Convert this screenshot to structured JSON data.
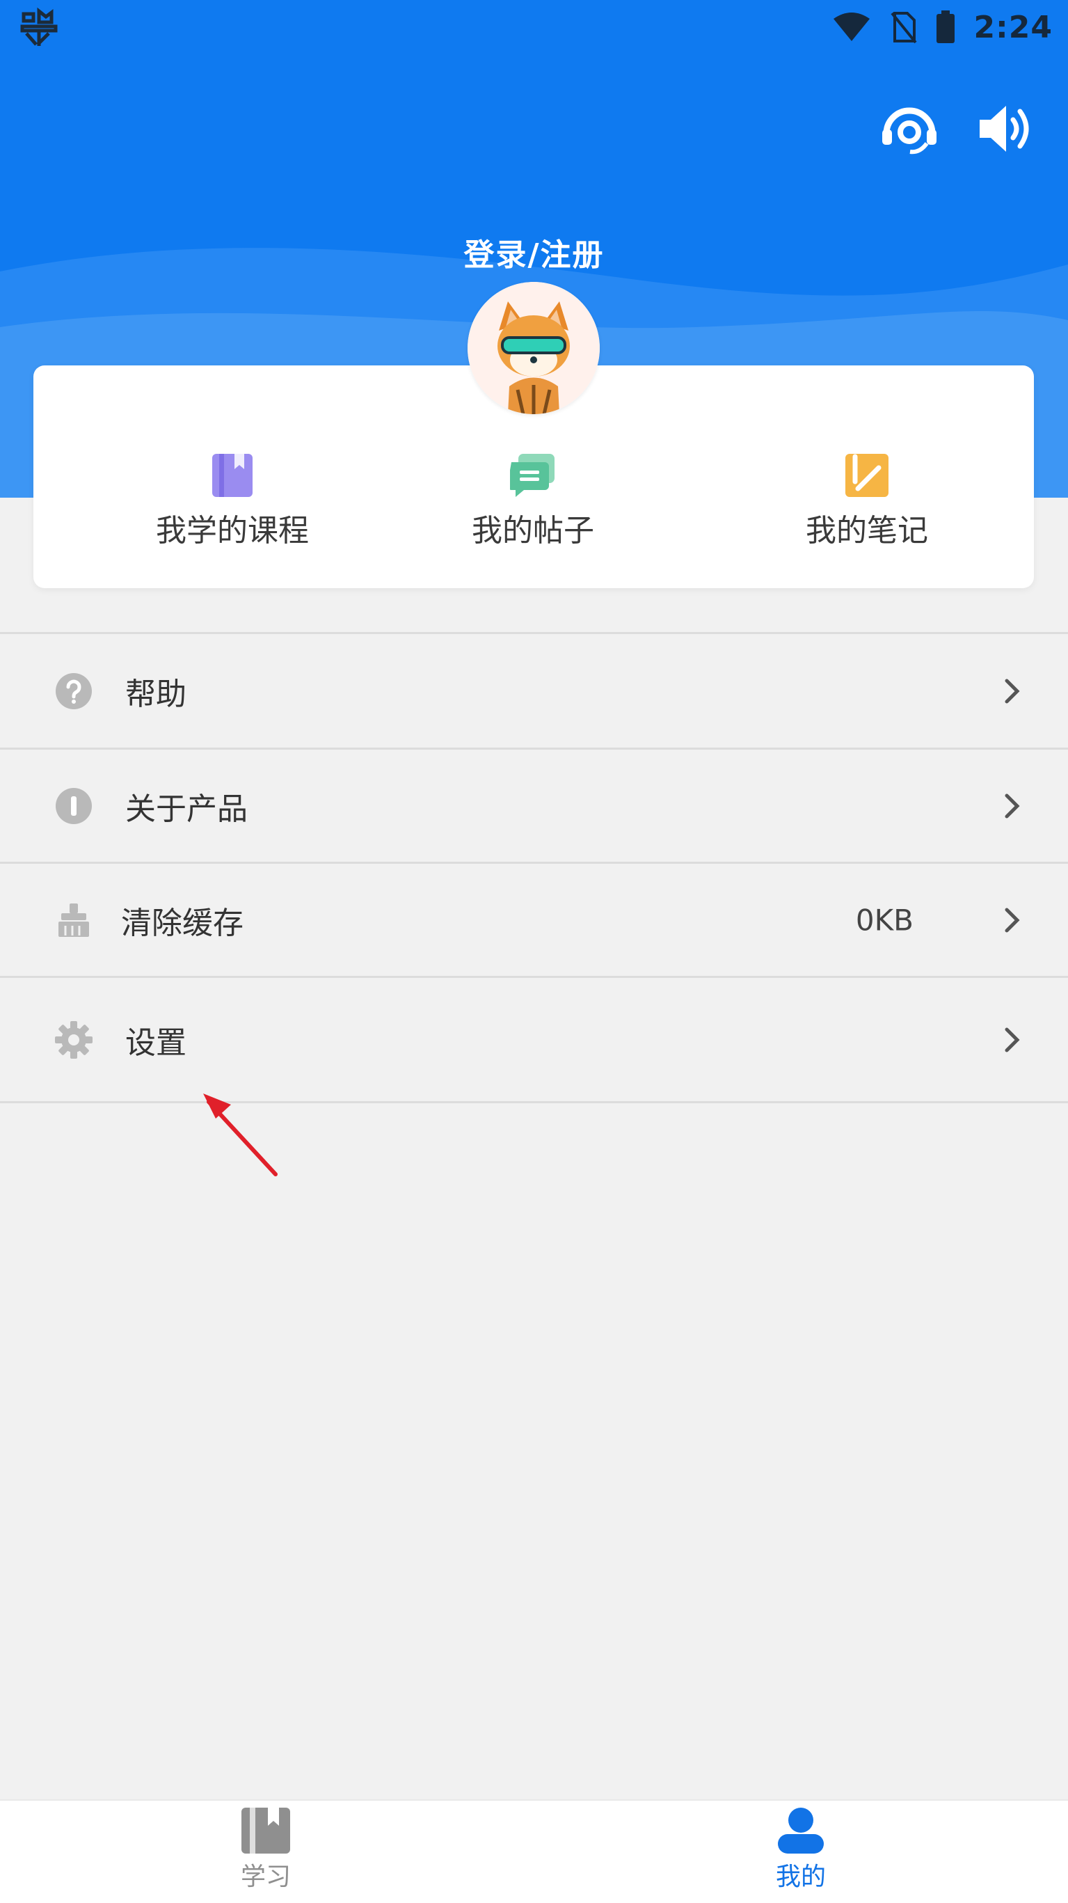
{
  "status_bar": {
    "time": "2:24"
  },
  "header": {
    "login_label": "登录/注册",
    "support_icon": "headset-icon",
    "sound_icon": "speaker-icon"
  },
  "quick_actions": [
    {
      "label": "我学的课程",
      "icon": "book-icon",
      "color": "#9a8cf0"
    },
    {
      "label": "我的帖子",
      "icon": "chat-icon",
      "color": "#58c39a"
    },
    {
      "label": "我的笔记",
      "icon": "note-icon",
      "color": "#f6b544"
    }
  ],
  "menu": [
    {
      "label": "帮助",
      "icon": "help-icon",
      "value": ""
    },
    {
      "label": "关于产品",
      "icon": "info-icon",
      "value": ""
    },
    {
      "label": "清除缓存",
      "icon": "broom-icon",
      "value": "0KB"
    },
    {
      "label": "设置",
      "icon": "gear-icon",
      "value": ""
    }
  ],
  "tabs": [
    {
      "label": "学习",
      "icon": "book-tab-icon",
      "active": false
    },
    {
      "label": "我的",
      "icon": "person-tab-icon",
      "active": true
    }
  ],
  "colors": {
    "header": "#0f7af0",
    "tab_active": "#1273e6",
    "tab_inactive": "#8f8f8f",
    "annotation": "#e0202a"
  }
}
